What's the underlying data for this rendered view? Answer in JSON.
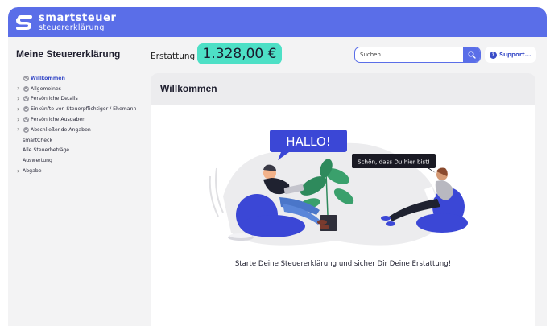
{
  "app": {
    "brand_line1": "smartsteuer",
    "brand_line2": "steuererklärung"
  },
  "header": {
    "page_title": "Meine Steuererklärung",
    "refund_label": "Erstattung",
    "refund_amount": "1.328,00 €",
    "search_placeholder": "Suchen",
    "support_label": "Support..."
  },
  "sidebar": {
    "items": [
      {
        "label": "Willkommen",
        "expandable": false,
        "checked": true,
        "active": true
      },
      {
        "label": "Allgemeines",
        "expandable": true,
        "checked": true,
        "active": false
      },
      {
        "label": "Persönliche Details",
        "expandable": true,
        "checked": true,
        "active": false
      },
      {
        "label": "Einkünfte von Steuerpflichtiger / Ehemann",
        "expandable": true,
        "checked": true,
        "active": false
      },
      {
        "label": "Persönliche Ausgaben",
        "expandable": true,
        "checked": true,
        "active": false
      },
      {
        "label": "Abschließende Angaben",
        "expandable": true,
        "checked": true,
        "active": false
      },
      {
        "label": "smartCheck",
        "expandable": false,
        "checked": false,
        "active": false
      },
      {
        "label": "Alle Steuerbeträge",
        "expandable": false,
        "checked": false,
        "active": false
      },
      {
        "label": "Auswertung",
        "expandable": false,
        "checked": false,
        "active": false
      },
      {
        "label": "Abgabe",
        "expandable": true,
        "checked": false,
        "active": false
      }
    ]
  },
  "main": {
    "card_title": "Willkommen",
    "bubble_hello": "HALLO!",
    "bubble_reply": "Schön, dass Du hier bist!",
    "tagline": "Starte Deine Steuererklärung und sicher Dir Deine Erstattung!"
  },
  "colors": {
    "brand_blue": "#5a6ee8",
    "refund_green": "#4de0c6",
    "chair_blue": "#3b47d6"
  }
}
